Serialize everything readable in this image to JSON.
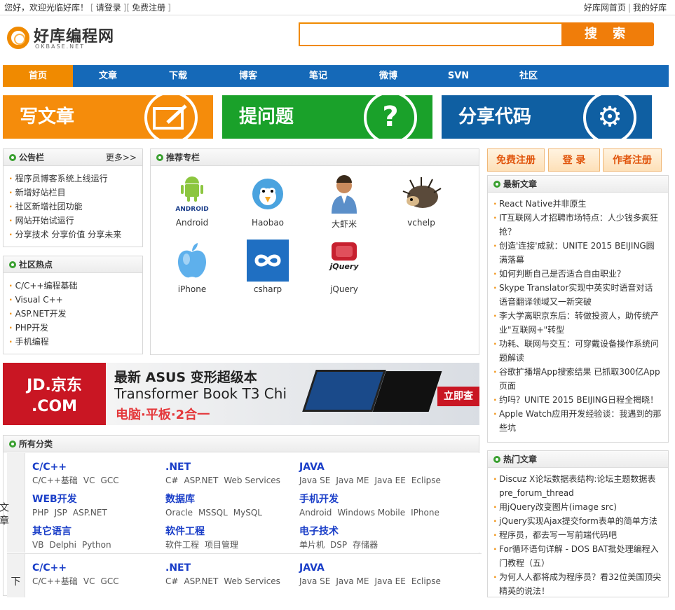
{
  "topbar": {
    "greeting": "您好，欢迎光临好库！",
    "login": "请登录",
    "register": "免费注册",
    "home": "好库网首页",
    "mine": "我的好库"
  },
  "logo": {
    "text": "好库编程网",
    "sub": "OKBASE.NET"
  },
  "search": {
    "placeholder": "",
    "button": "搜 索"
  },
  "nav": [
    "首页",
    "文章",
    "下载",
    "博客",
    "笔记",
    "微博",
    "SVN",
    "社区"
  ],
  "banners": {
    "write": "写文章",
    "ask": "提问题",
    "share": "分享代码"
  },
  "notice": {
    "title": "公告栏",
    "more": "更多>>",
    "items": [
      "程序员博客系统上线运行",
      "新增好站栏目",
      "社区新增社团功能",
      "网站开始试运行",
      "分享技术 分享价值 分享未来"
    ]
  },
  "hot_community": {
    "title": "社区热点",
    "items": [
      "C/C++编程基础",
      "Visual C++",
      "ASP.NET开发",
      "PHP开发",
      "手机编程"
    ]
  },
  "columns": {
    "title": "推荐专栏",
    "items": [
      "Android",
      "Haobao",
      "大虾米",
      "vchelp",
      "iPhone",
      "csharp",
      "jQuery"
    ],
    "android_logo_text": "ANDROID",
    "jquery_logo_text": "jQuery"
  },
  "ad": {
    "jd_top": "JD.京东",
    "jd_bottom": ".COM",
    "line1": "最新 ASUS 变形超级本",
    "line2": "Transformer Book T3 Chi",
    "line3": "电脑·平板·2合一",
    "button": "立即查"
  },
  "categories": {
    "title": "所有分类",
    "side_top": "文 章",
    "side_bottom": "下",
    "rows": [
      [
        {
          "title": "C/C++",
          "links": [
            "C/C++基础",
            "VC",
            "GCC"
          ]
        },
        {
          "title": ".NET",
          "links": [
            "C#",
            "ASP.NET",
            "Web Services"
          ]
        },
        {
          "title": "JAVA",
          "links": [
            "Java SE",
            "Java ME",
            "Java EE",
            "Eclipse"
          ]
        }
      ],
      [
        {
          "title": "WEB开发",
          "links": [
            "PHP",
            "JSP",
            "ASP.NET"
          ]
        },
        {
          "title": "数据库",
          "links": [
            "Oracle",
            "MSSQL",
            "MySQL"
          ]
        },
        {
          "title": "手机开发",
          "links": [
            "Android",
            "Windows Mobile",
            "IPhone"
          ]
        }
      ],
      [
        {
          "title": "其它语言",
          "links": [
            "VB",
            "Delphi",
            "Python"
          ]
        },
        {
          "title": "软件工程",
          "links": [
            "软件工程",
            "项目管理"
          ]
        },
        {
          "title": "电子技术",
          "links": [
            "单片机",
            "DSP",
            "存储器"
          ]
        }
      ],
      [
        {
          "title": "C/C++",
          "links": [
            "C/C++基础",
            "VC",
            "GCC"
          ]
        },
        {
          "title": ".NET",
          "links": [
            "C#",
            "ASP.NET",
            "Web Services"
          ]
        },
        {
          "title": "JAVA",
          "links": [
            "Java SE",
            "Java ME",
            "Java EE",
            "Eclipse"
          ]
        }
      ]
    ]
  },
  "right_buttons": {
    "register": "免费注册",
    "login": "登 录",
    "author": "作者注册"
  },
  "latest": {
    "title": "最新文章",
    "items": [
      "React Native并非原生",
      "IT互联网人才招聘市场特点：人少钱多疯狂抢？",
      "创造'连接'成就：UNITE 2015 BEIJING圆满落幕",
      "如何判断自己是否适合自由职业？",
      "Skype Translator实现中英实时语音对话 语音翻译领域又一新突破",
      "李大学离职京东后：转做投资人，助传统产业\"互联网+\"转型",
      "功耗、联网与交互：可穿戴设备操作系统问题解读",
      "谷歌扩播增App搜索结果 已抓取300亿App页面",
      "约吗？UNITE 2015 BEIJING日程全揭晓！",
      "Apple Watch应用开发经验谈：我遇到的那些坑"
    ]
  },
  "hot_articles": {
    "title": "热门文章",
    "items": [
      "Discuz X论坛数据表结构:论坛主题数据表pre_forum_thread",
      "用jQuery改变图片(image src)",
      "jQuery实现Ajax提交form表单的简单方法",
      "程序员，都去写一写前端代码吧",
      "For循环语句详解 - DOS BAT批处理编程入门教程（五）",
      "为何人人都将成为程序员？看32位美国顶尖精英的说法！"
    ]
  }
}
